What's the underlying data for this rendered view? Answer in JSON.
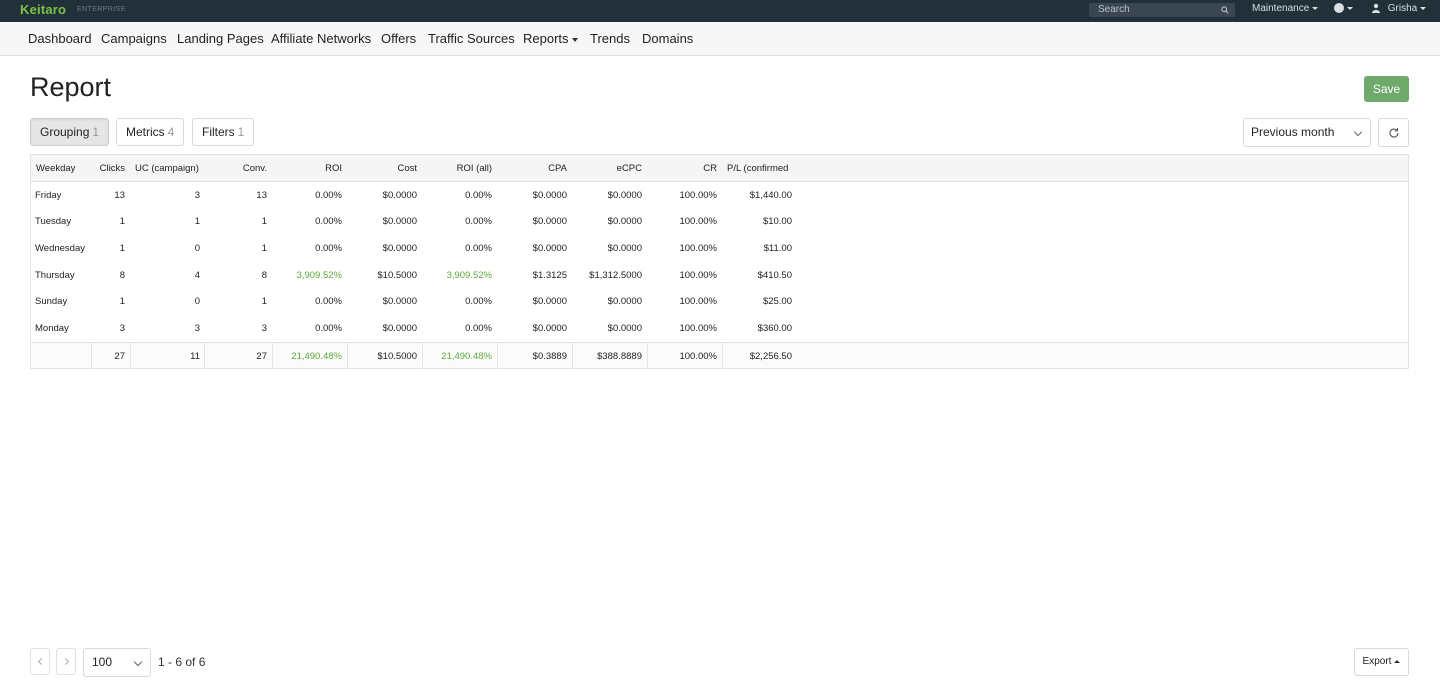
{
  "app": {
    "logo": "Keitaro",
    "edition": "ENTERPRISE"
  },
  "topbar": {
    "search_placeholder": "Search",
    "maintenance_label": "Maintenance",
    "help_label": "?",
    "user_label": "Grisha"
  },
  "nav": {
    "items": [
      "Dashboard",
      "Campaigns",
      "Landing Pages",
      "Affiliate Networks",
      "Offers",
      "Traffic Sources",
      "Reports",
      "Trends",
      "Domains"
    ]
  },
  "page": {
    "title": "Report",
    "save_label": "Save"
  },
  "controls": {
    "grouping_label": "Grouping",
    "grouping_count": "1",
    "metrics_label": "Metrics",
    "metrics_count": "4",
    "filters_label": "Filters",
    "filters_count": "1",
    "range_value": "Previous month"
  },
  "table": {
    "headers": [
      "Weekday",
      "Clicks",
      "UC (campaign)",
      "Conv.",
      "ROI",
      "Cost",
      "ROI (all)",
      "CPA",
      "eCPC",
      "CR",
      "P/L (confirmed"
    ],
    "rows": [
      [
        "Friday",
        "13",
        "3",
        "13",
        "0.00%",
        "$0.0000",
        "0.00%",
        "$0.0000",
        "$0.0000",
        "100.00%",
        "$1,440.00"
      ],
      [
        "Tuesday",
        "1",
        "1",
        "1",
        "0.00%",
        "$0.0000",
        "0.00%",
        "$0.0000",
        "$0.0000",
        "100.00%",
        "$10.00"
      ],
      [
        "Wednesday",
        "1",
        "0",
        "1",
        "0.00%",
        "$0.0000",
        "0.00%",
        "$0.0000",
        "$0.0000",
        "100.00%",
        "$11.00"
      ],
      [
        "Thursday",
        "8",
        "4",
        "8",
        "3,909.52%",
        "$10.5000",
        "3,909.52%",
        "$1.3125",
        "$1,312.5000",
        "100.00%",
        "$410.50"
      ],
      [
        "Sunday",
        "1",
        "0",
        "1",
        "0.00%",
        "$0.0000",
        "0.00%",
        "$0.0000",
        "$0.0000",
        "100.00%",
        "$25.00"
      ],
      [
        "Monday",
        "3",
        "3",
        "3",
        "0.00%",
        "$0.0000",
        "0.00%",
        "$0.0000",
        "$0.0000",
        "100.00%",
        "$360.00"
      ]
    ],
    "totals": [
      "",
      "27",
      "11",
      "27",
      "21,490.48%",
      "$10.5000",
      "21,490.48%",
      "$0.3889",
      "$388.8889",
      "100.00%",
      "$2,256.50"
    ],
    "positive_color": "#5caa3c"
  },
  "pagination": {
    "per_page": "100",
    "info": "1 - 6 of 6",
    "export_label": "Export"
  },
  "colors": {
    "topbar": "#22303a",
    "brand": "#7cc244",
    "save": "#6fa96b"
  }
}
